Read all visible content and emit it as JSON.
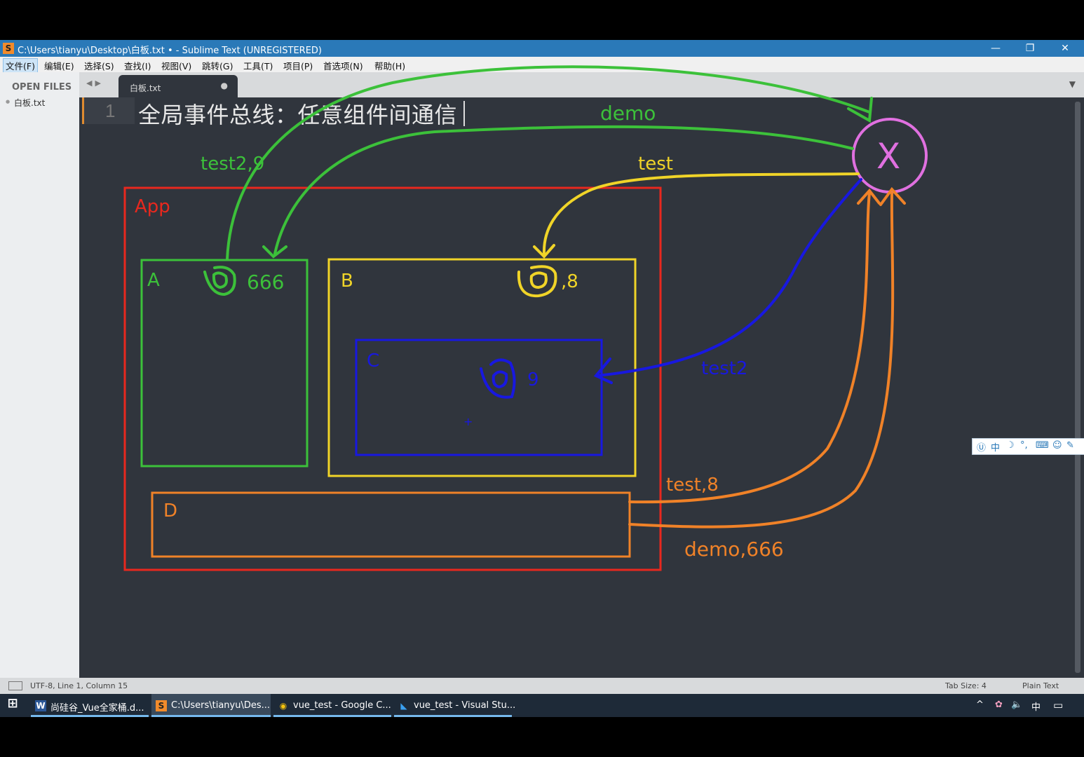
{
  "window": {
    "title": "C:\\Users\\tianyu\\Desktop\\白板.txt • - Sublime Text (UNREGISTERED)",
    "controls": {
      "minimize": "—",
      "restore": "❐",
      "close": "✕"
    }
  },
  "menu": [
    "文件(F)",
    "编辑(E)",
    "选择(S)",
    "查找(I)",
    "视图(V)",
    "跳转(G)",
    "工具(T)",
    "项目(P)",
    "首选项(N)",
    "帮助(H)"
  ],
  "sidebar": {
    "header": "OPEN FILES",
    "files": [
      "白板.txt"
    ]
  },
  "tabs": [
    {
      "label": "白板.txt",
      "modified": "●"
    }
  ],
  "editor": {
    "line_number": "1",
    "line_text": "全局事件总线：任意组件间通信"
  },
  "drawing": {
    "boxes": {
      "app": "App",
      "a": "A",
      "b": "B",
      "c": "C",
      "d": "D"
    },
    "hub": "X",
    "labels": {
      "demo": "demo",
      "test2_9": "test2,9",
      "test": "test",
      "a_value": "666",
      "b_value": ",8",
      "c_value": "9",
      "test2": "test2",
      "test_8": "test,8",
      "demo_666": "demo,666"
    },
    "colors": {
      "app": "#e8281e",
      "a": "#3cc13a",
      "b": "#f0d428",
      "c": "#1818e0",
      "d": "#f08228",
      "hub": "#e070e0"
    }
  },
  "ime": {
    "items": [
      "Ⓤ",
      "中",
      "☽",
      "°,",
      "⌨",
      "☺",
      "✎"
    ]
  },
  "status": {
    "left": "UTF-8, Line 1, Column 15",
    "tab_size": "Tab Size: 4",
    "syntax": "Plain Text"
  },
  "taskbar": {
    "start": "⊞",
    "items": [
      {
        "icon": "W",
        "label": "尚硅谷_Vue全家桶.d..."
      },
      {
        "icon": "S",
        "label": "C:\\Users\\tianyu\\Des..."
      },
      {
        "icon": "◉",
        "label": "vue_test - Google C..."
      },
      {
        "icon": "◣",
        "label": "vue_test - Visual Stu..."
      }
    ],
    "tray": [
      "^",
      "✿",
      "🔈",
      "中",
      "▭"
    ]
  }
}
